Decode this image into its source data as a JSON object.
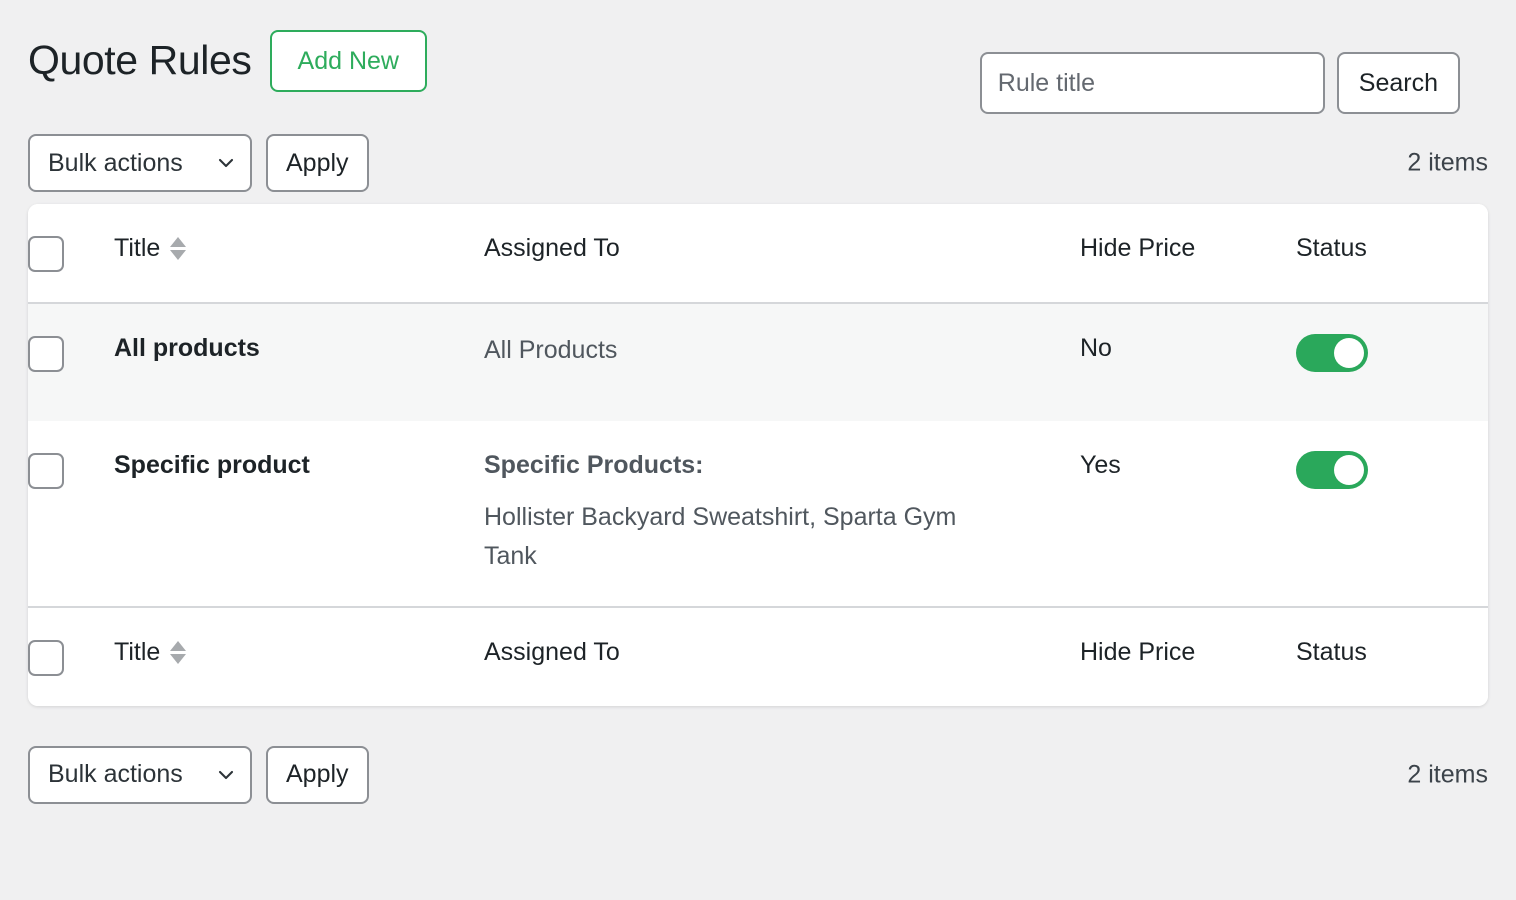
{
  "header": {
    "title": "Quote Rules",
    "add_new_label": "Add New"
  },
  "search": {
    "placeholder": "Rule title",
    "value": "",
    "button_label": "Search"
  },
  "tablenav_top": {
    "bulk_actions_label": "Bulk actions",
    "apply_label": "Apply",
    "items_count": "2 items"
  },
  "tablenav_bottom": {
    "bulk_actions_label": "Bulk actions",
    "apply_label": "Apply",
    "items_count": "2 items"
  },
  "table": {
    "columns": {
      "title": "Title",
      "assigned_to": "Assigned To",
      "hide_price": "Hide Price",
      "status": "Status"
    },
    "rows": [
      {
        "title": "All products",
        "assigned_label": "",
        "assigned_value": "All Products",
        "hide_price": "No",
        "status_on": true
      },
      {
        "title": "Specific product",
        "assigned_label": "Specific Products:",
        "assigned_value": "Hollister Backyard Sweatshirt, Sparta Gym Tank",
        "hide_price": "Yes",
        "status_on": true
      }
    ]
  },
  "colors": {
    "accent_green": "#2eac5c",
    "toggle_on": "#2aa85b",
    "page_background": "#f0f0f1",
    "row_alt_background": "#f6f7f7",
    "border": "#8c8f94"
  },
  "icons": {
    "chevron_down": "chevron-down-icon",
    "sort": "sort-arrows-icon"
  }
}
